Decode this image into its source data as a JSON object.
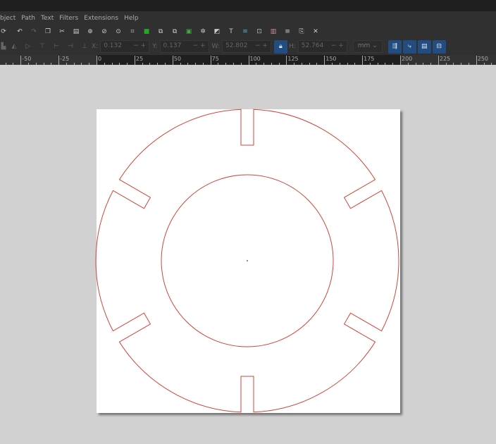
{
  "menu": [
    "bject",
    "Path",
    "Text",
    "Filters",
    "Extensions",
    "Help"
  ],
  "toolbar2": {
    "x_label": "X:",
    "x_value": "0.132",
    "y_label": "Y:",
    "y_value": "0.137",
    "w_label": "W:",
    "w_value": "52.802",
    "h_label": "H:",
    "h_value": "52.764",
    "unit": "mm",
    "lock_icon": "lock-icon"
  },
  "ruler": {
    "labels": [
      "-50",
      "-25",
      "0",
      "25",
      "50",
      "75",
      "100",
      "125",
      "150",
      "175",
      "200",
      "225",
      "250"
    ]
  },
  "colors": {
    "stroke": "#d0453a",
    "accent": "#234d80"
  }
}
